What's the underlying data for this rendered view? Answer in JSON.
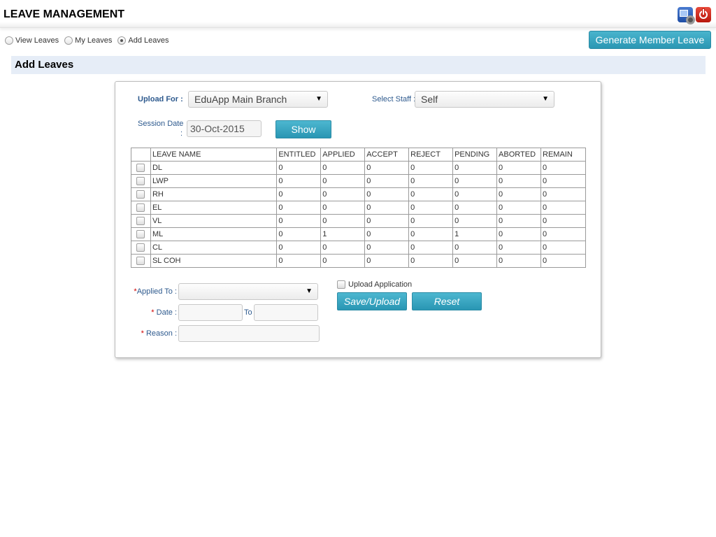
{
  "header": {
    "title": "LEAVE MANAGEMENT",
    "icons": [
      "settings-icon",
      "power-icon"
    ]
  },
  "nav": {
    "options": [
      {
        "label": "View Leaves",
        "checked": false
      },
      {
        "label": "My Leaves",
        "checked": false
      },
      {
        "label": "Add Leaves",
        "checked": true
      }
    ]
  },
  "generate_button": "Generate Member Leave",
  "section_title": "Add Leaves",
  "form": {
    "upload_for_label": "Upload For :",
    "upload_for_value": "EduApp Main Branch",
    "select_staff_label": "Select Staff :",
    "select_staff_value": "Self",
    "session_date_label": "Session Date",
    "session_date_colon": ":",
    "session_date_value": "30-Oct-2015",
    "show_button": "Show"
  },
  "table": {
    "headers": [
      "LEAVE NAME",
      "ENTITLED",
      "APPLIED",
      "ACCEPT",
      "REJECT",
      "PENDING",
      "ABORTED",
      "REMAIN"
    ],
    "rows": [
      [
        "DL",
        "0",
        "0",
        "0",
        "0",
        "0",
        "0",
        "0"
      ],
      [
        "LWP",
        "0",
        "0",
        "0",
        "0",
        "0",
        "0",
        "0"
      ],
      [
        "RH",
        "0",
        "0",
        "0",
        "0",
        "0",
        "0",
        "0"
      ],
      [
        "EL",
        "0",
        "0",
        "0",
        "0",
        "0",
        "0",
        "0"
      ],
      [
        "VL",
        "0",
        "0",
        "0",
        "0",
        "0",
        "0",
        "0"
      ],
      [
        "ML",
        "0",
        "1",
        "0",
        "0",
        "1",
        "0",
        "0"
      ],
      [
        "CL",
        "0",
        "0",
        "0",
        "0",
        "0",
        "0",
        "0"
      ],
      [
        "SL COH",
        "0",
        "0",
        "0",
        "0",
        "0",
        "0",
        "0"
      ]
    ]
  },
  "apply": {
    "applied_to_label": "Applied To :",
    "applied_to_value": "",
    "date_label": "Date :",
    "to_label": "To",
    "from_value": "",
    "to_value": "",
    "reason_label": "Reason :",
    "reason_value": "",
    "required_mark": "*",
    "upload_application_label": "Upload Application",
    "save_button": "Save/Upload",
    "reset_button": "Reset"
  },
  "colors": {
    "accent": "#2b97b3",
    "label": "#2e5a8e",
    "section_bg": "#e6edf7",
    "required": "#d00000"
  }
}
